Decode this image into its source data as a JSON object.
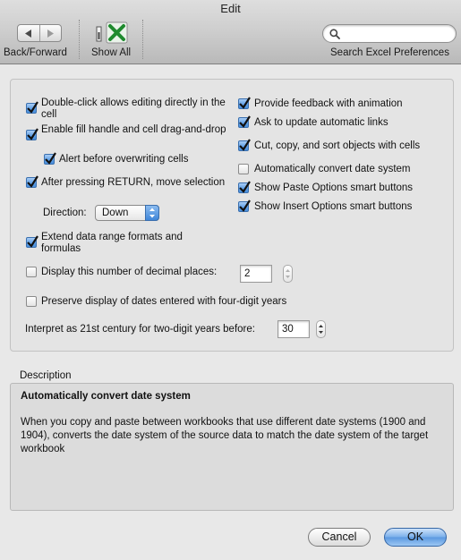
{
  "window": {
    "title": "Edit"
  },
  "toolbar": {
    "back_forward_label": "Back/Forward",
    "show_all_label": "Show All",
    "search_label": "Search Excel Preferences",
    "search_placeholder": ""
  },
  "options": {
    "double_click_edit": {
      "label": "Double-click allows editing directly in the cell",
      "checked": true
    },
    "fill_handle": {
      "label": "Enable fill handle and cell drag-and-drop",
      "checked": true
    },
    "alert_overwrite": {
      "label": "Alert before overwriting cells",
      "checked": true
    },
    "move_selection": {
      "label": "After pressing RETURN, move selection",
      "checked": true
    },
    "direction_label": "Direction:",
    "direction_value": "Down",
    "extend_formats": {
      "label": "Extend data range formats and formulas",
      "checked": true
    },
    "decimal_places": {
      "label": "Display this number of decimal places:",
      "checked": false,
      "value": "2"
    },
    "four_digit_years": {
      "label": "Preserve display of dates entered with four-digit years",
      "checked": false
    },
    "century_label": "Interpret as 21st century for two-digit years before:",
    "century_value": "30",
    "feedback_animation": {
      "label": "Provide feedback with animation",
      "checked": true
    },
    "update_links": {
      "label": "Ask to update automatic links",
      "checked": true
    },
    "cut_copy_sort": {
      "label": "Cut, copy, and sort objects with cells",
      "checked": true
    },
    "convert_date_system": {
      "label": "Automatically convert date system",
      "checked": false
    },
    "paste_options": {
      "label": "Show Paste Options smart buttons",
      "checked": true
    },
    "insert_options": {
      "label": "Show Insert Options smart buttons",
      "checked": true
    }
  },
  "description": {
    "section_label": "Description",
    "heading": "Automatically convert date system",
    "body": "When you copy and paste between workbooks that use different date systems (1900 and 1904), converts the date system of the source data to match the date system of the target workbook"
  },
  "buttons": {
    "cancel": "Cancel",
    "ok": "OK"
  },
  "colors": {
    "accent": "#4b8fdb",
    "background": "#e8e8e8",
    "excel_green": "#1f8a2e"
  }
}
